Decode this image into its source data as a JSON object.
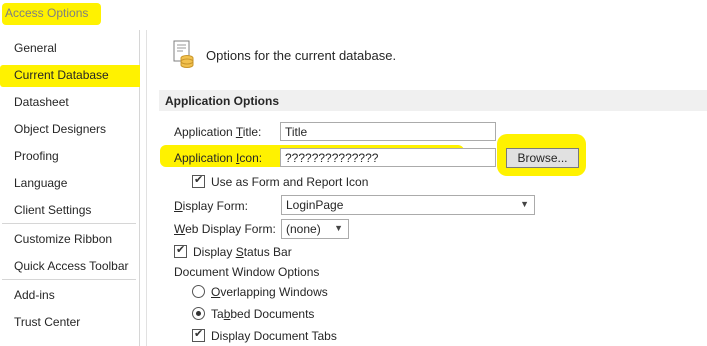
{
  "window": {
    "title": "Access Options"
  },
  "sidebar": {
    "items": [
      {
        "label": "General"
      },
      {
        "label": "Current Database"
      },
      {
        "label": "Datasheet"
      },
      {
        "label": "Object Designers"
      },
      {
        "label": "Proofing"
      },
      {
        "label": "Language"
      },
      {
        "label": "Client Settings"
      },
      {
        "label": "Customize Ribbon"
      },
      {
        "label": "Quick Access Toolbar"
      },
      {
        "label": "Add-ins"
      },
      {
        "label": "Trust Center"
      }
    ],
    "selected": "Current Database"
  },
  "header": {
    "text": "Options for the current database."
  },
  "section": {
    "title": "Application Options"
  },
  "app_title": {
    "label_pre": "Application ",
    "label_ul": "T",
    "label_post": "itle:",
    "value": "Title"
  },
  "app_icon": {
    "label_pre": "Application ",
    "label_ul": "I",
    "label_post": "con:",
    "value": "??????????????",
    "browse_label": "Browse..."
  },
  "use_as_form_icon": {
    "label": "Use as Form and Report Icon",
    "checked": true
  },
  "display_form": {
    "label_ul": "D",
    "label_post": "isplay Form:",
    "value": "LoginPage"
  },
  "web_display_form": {
    "label_ul": "W",
    "label_post": "eb Display Form:",
    "value": "(none)"
  },
  "display_status_bar": {
    "label_pre": "Display ",
    "label_ul": "S",
    "label_post": "tatus Bar",
    "checked": true
  },
  "doc_window": {
    "label": "Document Window Options",
    "overlapping": {
      "label_ul": "O",
      "label_post": "verlapping Windows",
      "selected": false
    },
    "tabbed": {
      "label_pre": "Ta",
      "label_ul": "b",
      "label_post": "bed Documents",
      "selected": true
    },
    "doc_tabs": {
      "label": "Display Document Tabs",
      "checked": true
    }
  },
  "colors": {
    "highlight": "#fff200",
    "section_bg": "#f0f0f0"
  }
}
